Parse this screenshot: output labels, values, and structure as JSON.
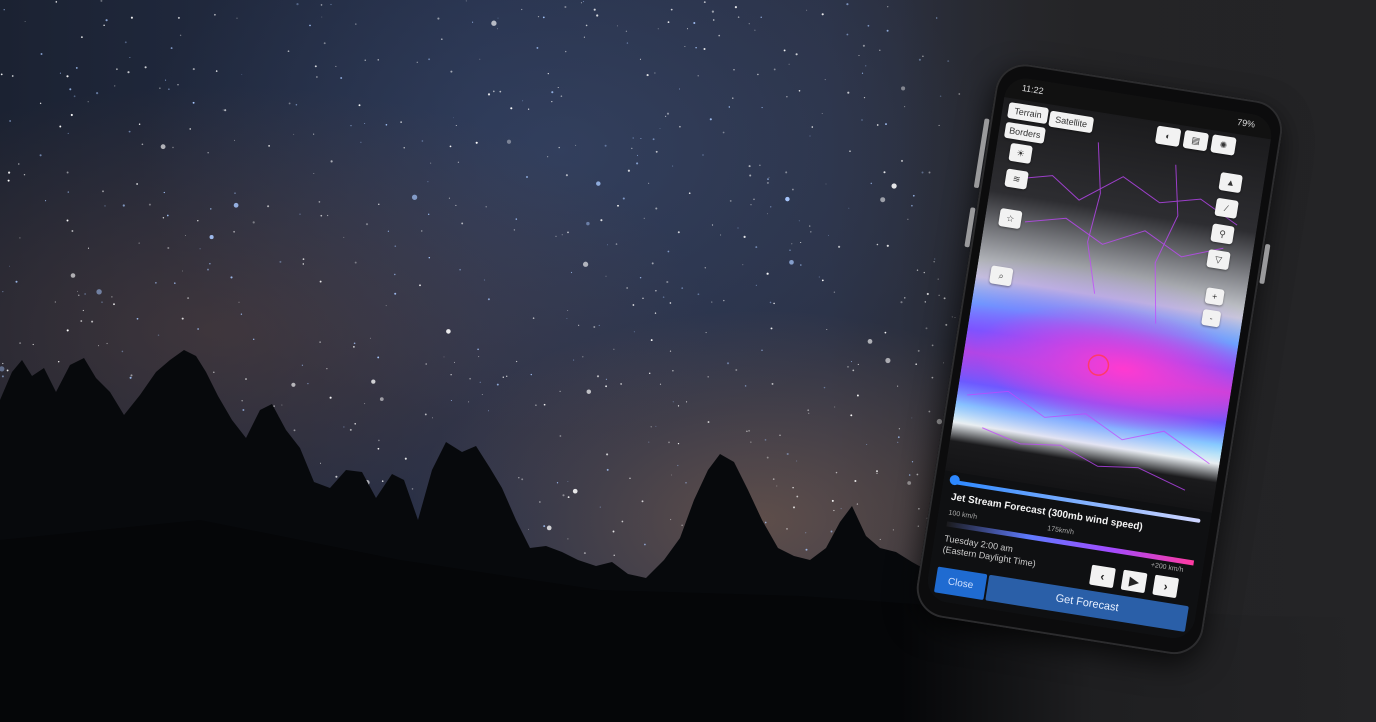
{
  "phone": {
    "status_time": "11:22",
    "battery": "79%",
    "map_layers": {
      "terrain": "Terrain",
      "satellite": "Satellite",
      "borders": "Borders"
    },
    "forecast_title": "Jet Stream Forecast (300mb wind speed)",
    "legend_low": "100 km/h",
    "legend_mid": "175km/h",
    "legend_high": "+200 km/h",
    "time_line1": "Tuesday 2:00 am",
    "time_line2": "(Eastern Daylight Time)",
    "close_label": "Close",
    "get_forecast_label": "Get Forecast",
    "nav_prev": "‹",
    "nav_play": "▶",
    "nav_next": "›",
    "zoom_in": "+",
    "zoom_out": "-",
    "icons": [
      "layers-icon",
      "document-icon",
      "settings-icon",
      "location-icon",
      "ruler-icon",
      "pin-icon",
      "filter-icon",
      "star-icon",
      "search-icon",
      "wind-icon",
      "sun-icon"
    ]
  }
}
